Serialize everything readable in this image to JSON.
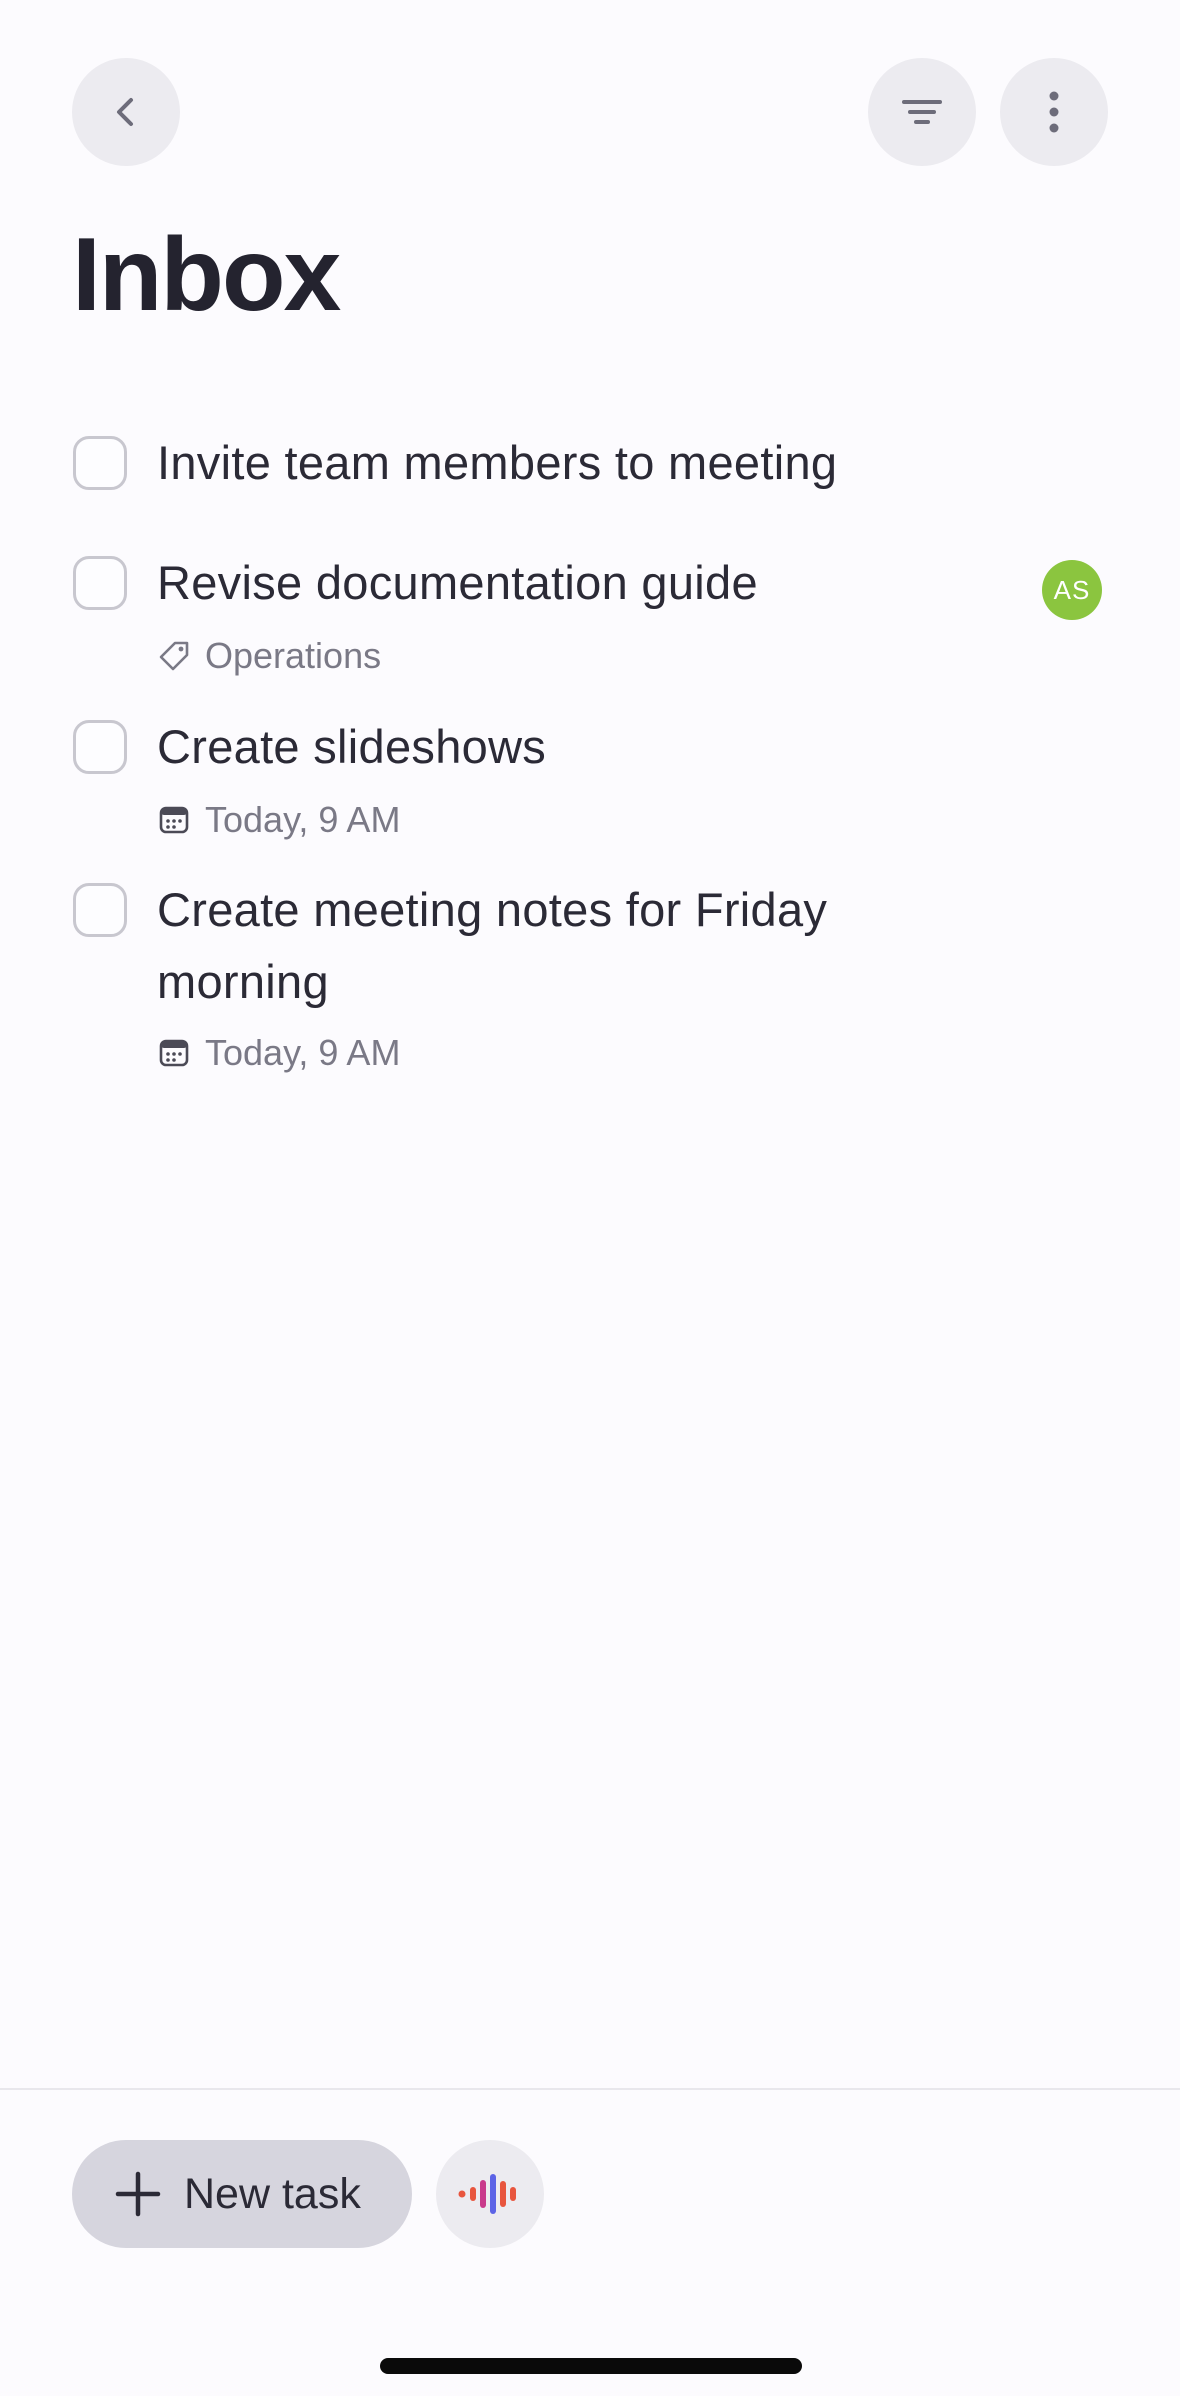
{
  "header": {
    "back_icon": "chevron-left-icon",
    "filter_icon": "filter-lines-icon",
    "more_icon": "vertical-ellipsis-icon",
    "title": "Inbox"
  },
  "tasks": [
    {
      "title": "Invite team members to meeting",
      "checked": false
    },
    {
      "title": "Revise documentation guide",
      "checked": false,
      "label": "Operations",
      "label_icon": "tag-icon",
      "assignee_initials": "AS",
      "assignee_color": "#8bc53f"
    },
    {
      "title": "Create slideshows",
      "checked": false,
      "due": "Today, 9 AM",
      "due_icon": "calendar-icon"
    },
    {
      "title": "Create meeting notes for Friday morning",
      "checked": false,
      "due": "Today, 9 AM",
      "due_icon": "calendar-icon"
    }
  ],
  "footer": {
    "new_task_label": "New task",
    "new_task_icon": "plus-icon",
    "voice_icon": "voice-assistant-icon"
  },
  "colors": {
    "background": "#fcfbfe",
    "title_text": "#24232f",
    "meta_text": "#7a7986",
    "button_bg": "#ecebf0",
    "new_task_bg": "#d6d5de",
    "avatar_bg": "#8bc53f"
  }
}
